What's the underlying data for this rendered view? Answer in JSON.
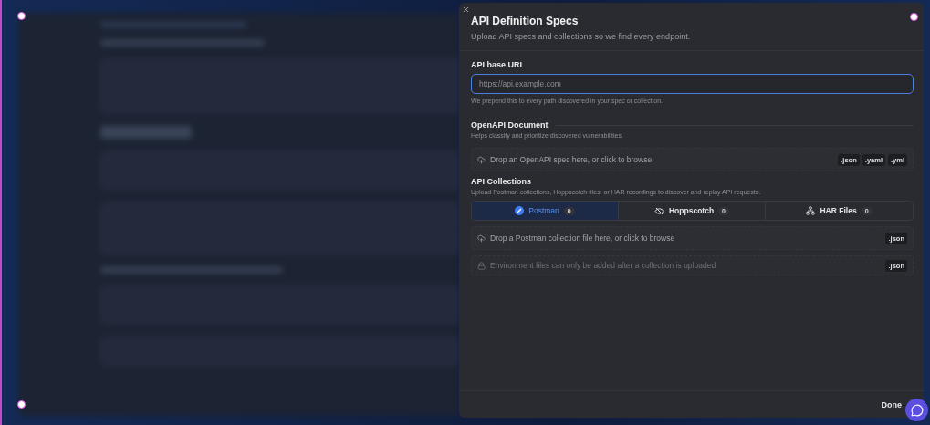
{
  "panel": {
    "title": "API Definition Specs",
    "subtitle": "Upload API specs and collections so we find every endpoint."
  },
  "base_url": {
    "label": "API base URL",
    "placeholder": "https://api.example.com",
    "hint": "We prepend this to every path discovered in your spec or collection."
  },
  "openapi": {
    "title": "OpenAPI Document",
    "description": "Helps classify and prioritize discovered vulnerabilities.",
    "dropzone": {
      "kind": "upload",
      "text": "Drop an OpenAPI spec here, or click to browse",
      "formats": [
        ".json",
        ".yaml",
        ".yml"
      ]
    }
  },
  "collections": {
    "title": "API Collections",
    "description": "Upload Postman collections, Hoppscotch files, or HAR recordings to discover and replay API requests.",
    "tabs": [
      {
        "kind": "postman",
        "label": "Postman",
        "count": "0",
        "selected": true
      },
      {
        "kind": "hoppscotch",
        "label": "Hoppscotch",
        "count": "0",
        "selected": false
      },
      {
        "kind": "har",
        "label": "HAR Files",
        "count": "0",
        "selected": false
      }
    ],
    "dropzones": [
      {
        "kind": "upload",
        "text": "Drop a Postman collection file here, or click to browse",
        "formats": [
          ".json"
        ]
      },
      {
        "kind": "locked",
        "text": "Environment files can only be added after a collection is uploaded",
        "formats": [
          ".json"
        ]
      }
    ]
  },
  "footer": {
    "button": "Done"
  }
}
